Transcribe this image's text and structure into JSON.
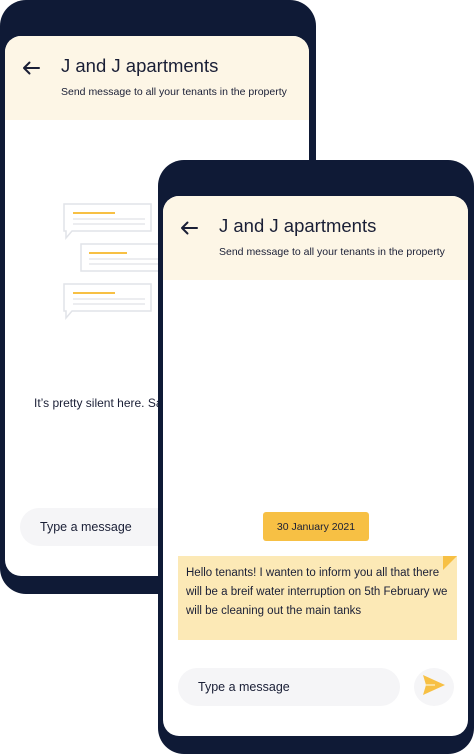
{
  "conversation": {
    "title": "J and J apartments",
    "subtitle": "Send message to all your tenants in the property"
  },
  "empty_state": {
    "text": "It’s pretty silent here. Sa"
  },
  "composer": {
    "placeholder": "Type a message"
  },
  "messages": {
    "date_badge": "30 January 2021",
    "items": [
      {
        "text": "Hello tenants! I wanten to inform you all that there will be a breif water interruption on 5th February we will be cleaning out the main tanks"
      }
    ]
  },
  "colors": {
    "frame": "#0f1a36",
    "header_bg": "#fdf6e6",
    "accent": "#f7c044",
    "bubble_bg": "#fce9b6",
    "composer_bg": "#f5f5f7"
  },
  "icons": {
    "back": "arrow-left-icon",
    "send": "send-icon",
    "empty": "chat-bubbles-icon"
  }
}
